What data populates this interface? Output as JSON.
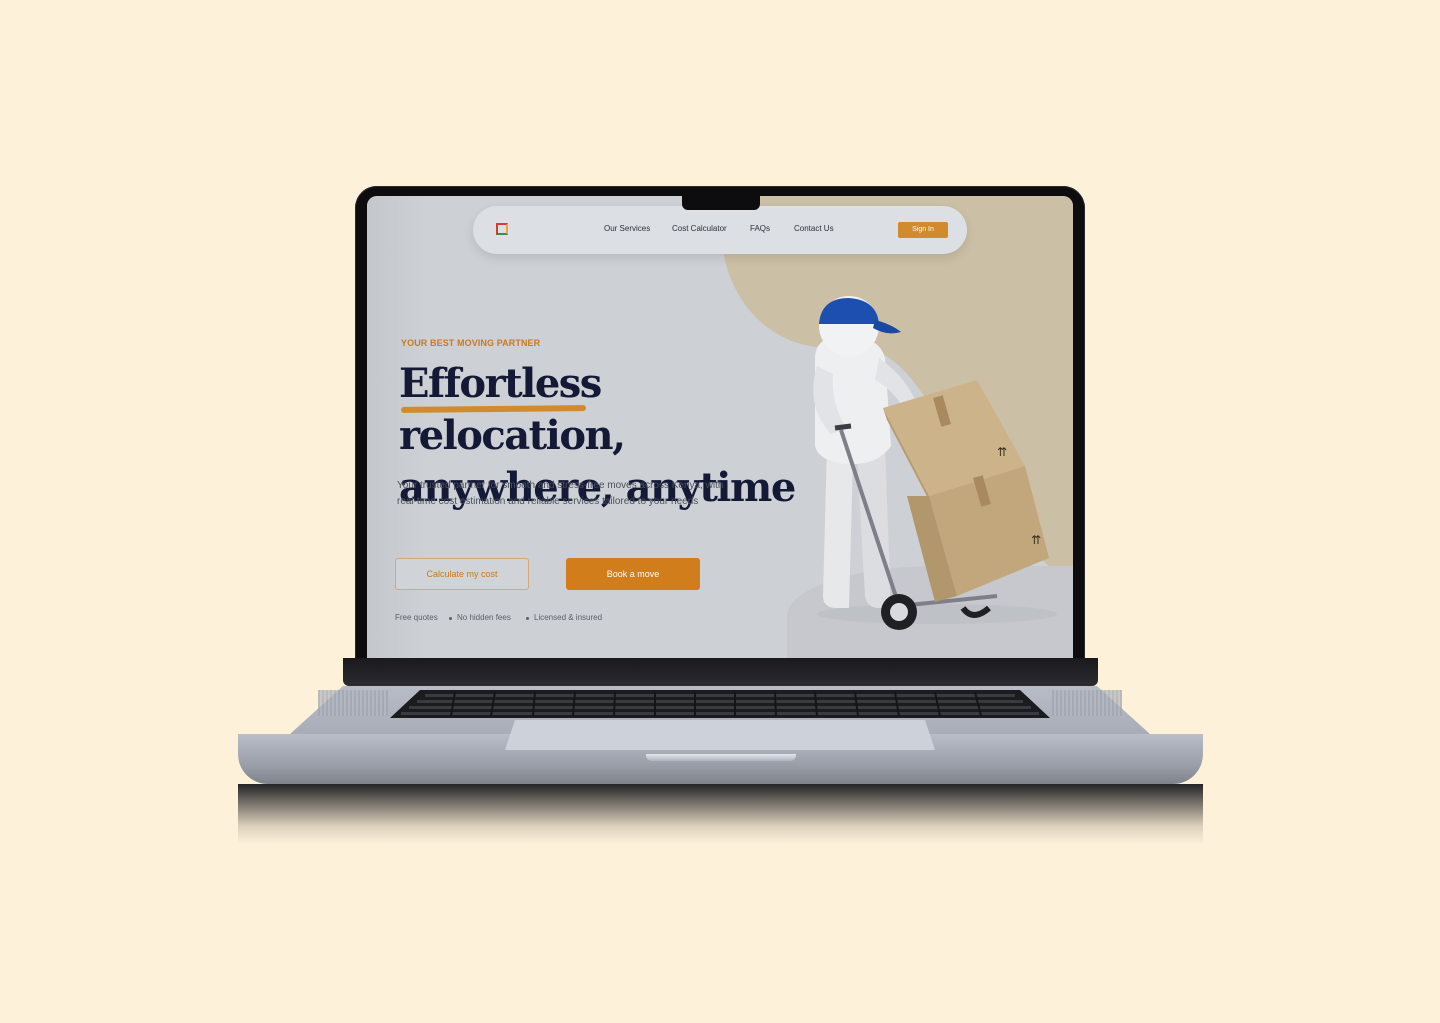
{
  "nav": {
    "links": [
      "Our Services",
      "Cost Calculator",
      "FAQs",
      "Contact Us"
    ],
    "signin_label": "Sign In"
  },
  "hero": {
    "eyebrow": "YOUR BEST MOVING PARTNER",
    "headline_line1": "Effortless relocation,",
    "headline_line2": "anywhere, anytime",
    "lead": "Your trusted partner for smooth and stress-free moves across Kenya, with real-time cost estimation and reliable services tailored to your needs",
    "primary_cta": "Book a move",
    "secondary_cta": "Calculate my cost",
    "features": [
      "Free quotes",
      "No hidden fees",
      "Licensed & insured"
    ]
  },
  "colors": {
    "page_bg": "#fdf1da",
    "accent": "#d17d1c",
    "headline": "#141a36",
    "screen_bg": "#cdd0d5",
    "blob": "#cbbfa6"
  },
  "icons": {
    "logo": "square-logo-icon",
    "illustration": "mover-with-hand-truck-illustration"
  }
}
